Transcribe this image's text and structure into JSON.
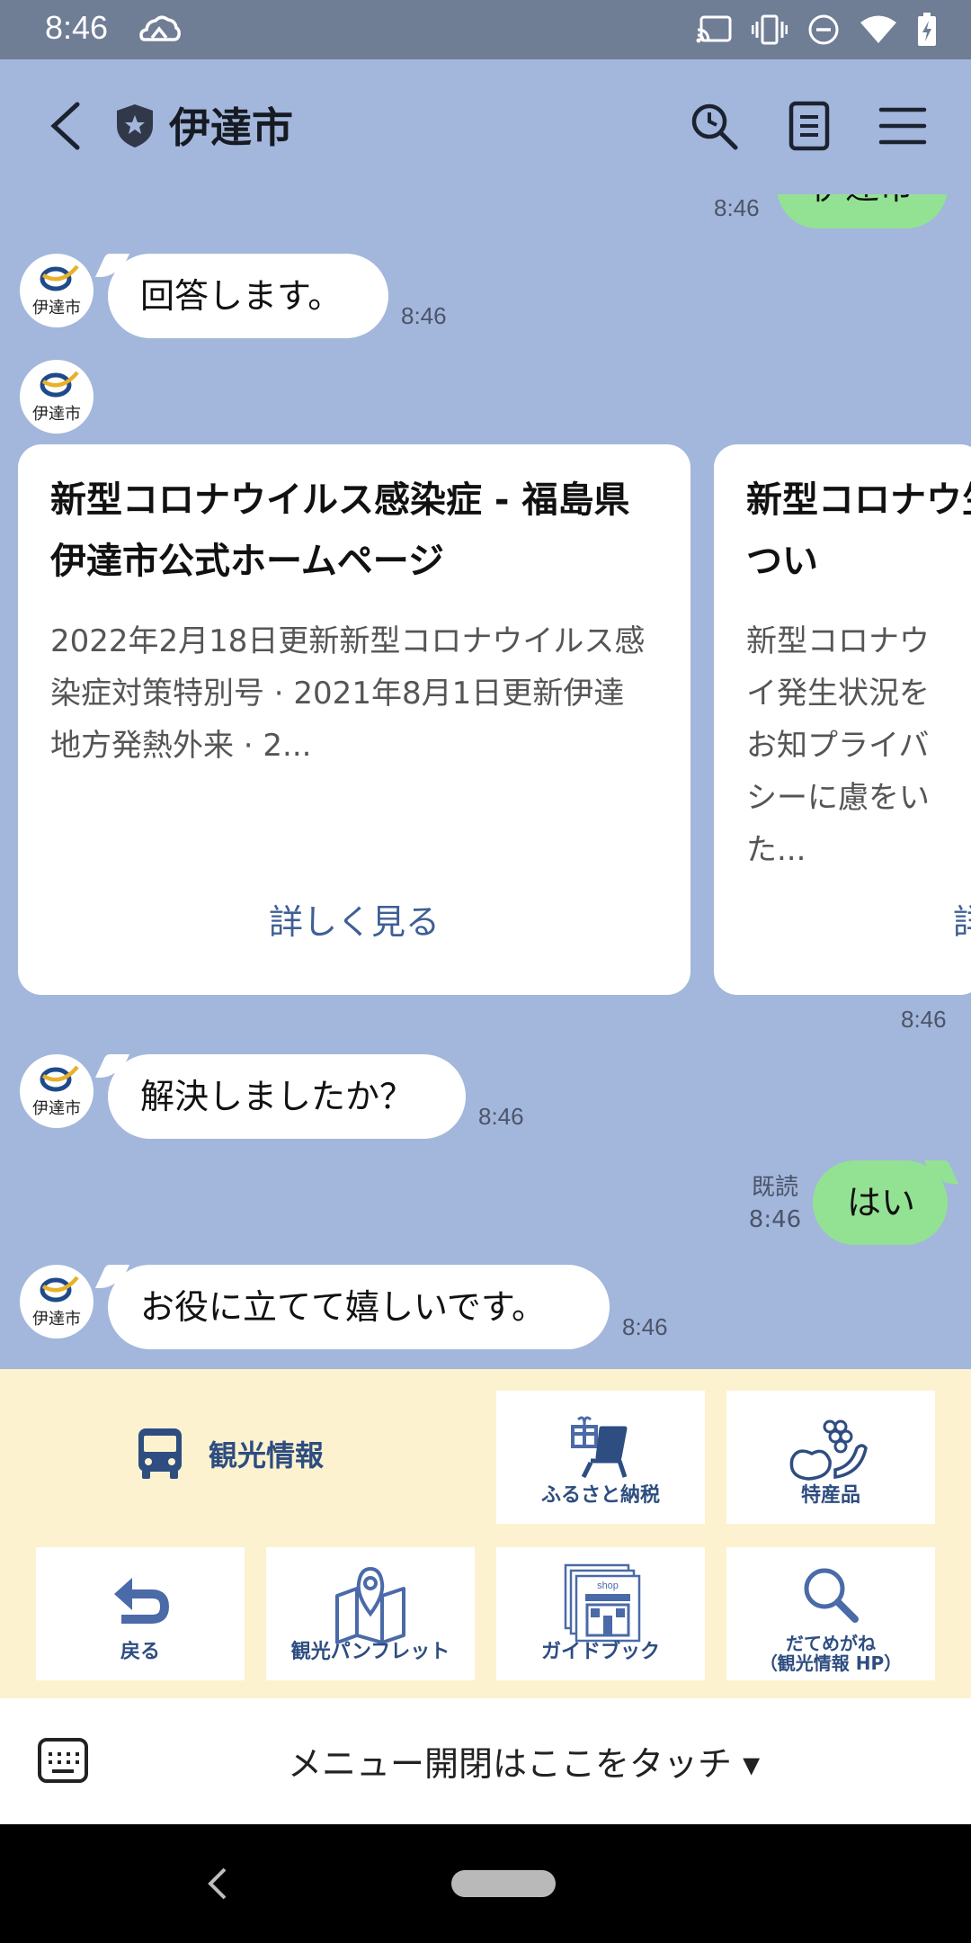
{
  "status_bar": {
    "time": "8:46",
    "icons": [
      "cloud-icon",
      "cast-icon",
      "vibrate-icon",
      "do-not-disturb-icon",
      "wifi-icon",
      "battery-icon"
    ]
  },
  "header": {
    "title": "伊達市",
    "icons": [
      "back-icon",
      "shield-icon",
      "search-icon",
      "notes-icon",
      "menu-icon"
    ]
  },
  "chat": {
    "avatar_text": "伊達市",
    "partial_user_message": {
      "text": "伊達市",
      "time": "8:46"
    },
    "messages": [
      {
        "side": "left",
        "text": "回答します。",
        "time": "8:46"
      },
      {
        "side": "left",
        "text": "解決しましたか？",
        "time": "8:46"
      },
      {
        "side": "right",
        "text": "はい",
        "read": "既読",
        "time": "8:46"
      },
      {
        "side": "left",
        "text": "お役に立てて嬉しいです。",
        "time": "8:46"
      }
    ],
    "carousel": {
      "time": "8:46",
      "cards": [
        {
          "title": "新型コロナウイルス感染症 - 福島県伊達市公式ホームページ",
          "description": "2022年2月18日更新新型コロナウイルス感染症対策特別号 · 2021年8月1日更新伊達地方発熱外来 · 2...",
          "link": "詳しく見る"
        },
        {
          "title": "新型コロナウ生状況につい",
          "description": "新型コロナウイ発生状況をお知プライバシーに慮をいた...",
          "link": "詳"
        }
      ]
    }
  },
  "rich_menu": {
    "feature": {
      "label": "観光情報",
      "icon": "bus-icon"
    },
    "tiles": [
      {
        "label": "ふるさと納税",
        "icon": "gift-chair-icon"
      },
      {
        "label": "特産品",
        "icon": "peach-grape-icon"
      },
      {
        "label": "戻る",
        "icon": "return-arrow-icon"
      },
      {
        "label": "観光パンフレット",
        "icon": "map-pin-icon"
      },
      {
        "label": "ガイドブック",
        "icon": "shop-book-icon",
        "sub": "shop"
      },
      {
        "label": "だてめがね",
        "label2": "（観光情報 HP）",
        "icon": "magnifier-icon"
      }
    ],
    "accent": "#2e4d80"
  },
  "input_bar": {
    "menu_toggle": "メニュー開閉はここをタッチ ▾"
  },
  "colors": {
    "chat_bg": "#a3b6dc",
    "status_bar": "#6f7d95",
    "user_bubble": "#93e293",
    "rich_menu_bg": "#fdf2d0"
  }
}
